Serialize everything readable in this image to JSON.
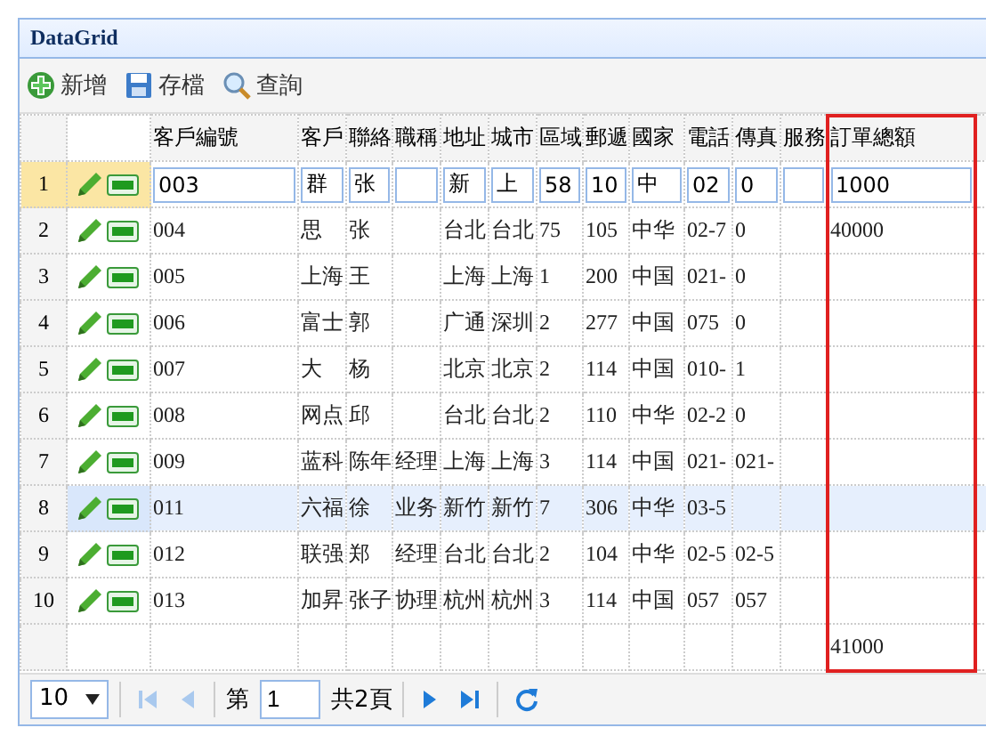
{
  "panel": {
    "title": "DataGrid"
  },
  "toolbar": [
    {
      "kind": "add",
      "label": "新增"
    },
    {
      "kind": "save",
      "label": "存檔"
    },
    {
      "kind": "search",
      "label": "查詢"
    }
  ],
  "columns": [
    {
      "label": "客戶編號",
      "highlighted": false
    },
    {
      "label": "客戶",
      "highlighted": false
    },
    {
      "label": "聯絡",
      "highlighted": false
    },
    {
      "label": "職稱",
      "highlighted": false
    },
    {
      "label": "地址",
      "highlighted": false
    },
    {
      "label": "城市",
      "highlighted": false
    },
    {
      "label": "區域",
      "highlighted": false
    },
    {
      "label": "郵遞",
      "highlighted": false
    },
    {
      "label": "國家",
      "highlighted": false
    },
    {
      "label": "電話",
      "highlighted": false
    },
    {
      "label": "傳真",
      "highlighted": false
    },
    {
      "label": "服務",
      "highlighted": false
    },
    {
      "label": "訂單總額",
      "highlighted": true
    }
  ],
  "rows": [
    {
      "number": "1",
      "editing": true,
      "selected": false,
      "cells": [
        "003",
        "群",
        "张",
        null,
        "新",
        "上",
        "58",
        "10",
        "中",
        "02",
        "0",
        null,
        "1000"
      ]
    },
    {
      "number": "2",
      "editing": false,
      "selected": false,
      "cells": [
        "004",
        "思",
        "张",
        null,
        "台北",
        "台北",
        "75",
        "105",
        "中华",
        "02-7",
        "0",
        null,
        "40000"
      ]
    },
    {
      "number": "3",
      "editing": false,
      "selected": false,
      "cells": [
        "005",
        "上海",
        "王",
        null,
        "上海",
        "上海",
        "1",
        "200",
        "中国",
        "021-",
        "0",
        null,
        null
      ]
    },
    {
      "number": "4",
      "editing": false,
      "selected": false,
      "cells": [
        "006",
        "富士",
        "郭",
        null,
        "广通",
        "深圳",
        "2",
        "277",
        "中国",
        "075",
        "0",
        null,
        null
      ]
    },
    {
      "number": "5",
      "editing": false,
      "selected": false,
      "cells": [
        "007",
        "大",
        "杨",
        null,
        "北京",
        "北京",
        "2",
        "114",
        "中国",
        "010-",
        "1",
        null,
        null
      ]
    },
    {
      "number": "6",
      "editing": false,
      "selected": false,
      "cells": [
        "008",
        "网点",
        "邱",
        null,
        "台北",
        "台北",
        "2",
        "110",
        "中华",
        "02-2",
        "0",
        null,
        null
      ]
    },
    {
      "number": "7",
      "editing": false,
      "selected": false,
      "cells": [
        "009",
        "蓝科",
        "陈年",
        "经理",
        "上海",
        "上海",
        "3",
        "114",
        "中国",
        "021-",
        "021-",
        null,
        null
      ]
    },
    {
      "number": "8",
      "editing": false,
      "selected": true,
      "cells": [
        "011",
        "六福",
        "徐",
        "业务",
        "新竹",
        "新竹",
        "7",
        "306",
        "中华",
        "03-5",
        null,
        null,
        null
      ]
    },
    {
      "number": "9",
      "editing": false,
      "selected": false,
      "cells": [
        "012",
        "联强",
        "郑",
        "经理",
        "台北",
        "台北",
        "2",
        "104",
        "中华",
        "02-5",
        "02-5",
        null,
        null
      ]
    },
    {
      "number": "10",
      "editing": false,
      "selected": false,
      "cells": [
        "013",
        "加昇",
        "张子",
        "协理",
        "杭州",
        "杭州",
        "3",
        "114",
        "中国",
        "057",
        "057",
        null,
        null
      ]
    }
  ],
  "footer": {
    "total": "41000"
  },
  "pager": {
    "page_size": "10",
    "page_prefix": "第",
    "page": "1",
    "page_suffix": "共2頁",
    "buttons": [
      {
        "kind": "first",
        "disabled": true
      },
      {
        "kind": "prev",
        "disabled": true
      },
      {
        "kind": "next",
        "disabled": false
      },
      {
        "kind": "last",
        "disabled": false
      },
      {
        "kind": "refresh",
        "disabled": false
      }
    ]
  }
}
